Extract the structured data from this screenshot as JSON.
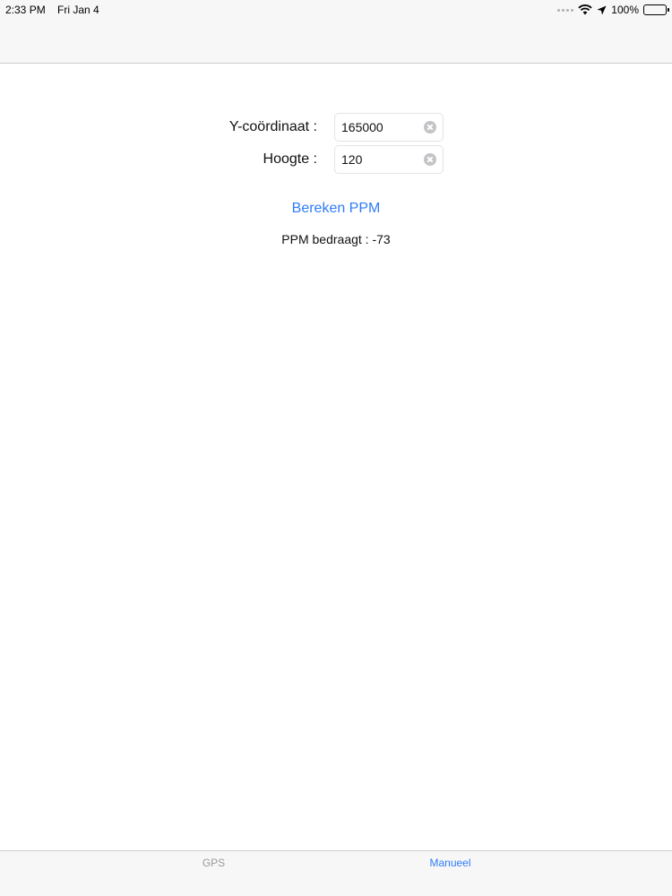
{
  "status_bar": {
    "time": "2:33 PM",
    "date": "Fri Jan 4",
    "battery_text": "100%",
    "battery_level": 1.0,
    "icons": [
      "signal-dots-icon",
      "wifi-icon",
      "location-arrow-icon",
      "battery-icon"
    ]
  },
  "form": {
    "y_coordinate": {
      "label": "Y-coördinaat :",
      "value": "165000"
    },
    "height": {
      "label": "Hoogte :",
      "value": "120"
    }
  },
  "calculate_button": {
    "label": "Bereken PPM"
  },
  "result": {
    "text": "PPM bedraagt : -73"
  },
  "tab_bar": {
    "tabs": [
      {
        "label": "GPS",
        "selected": false
      },
      {
        "label": "Manueel",
        "selected": true
      }
    ]
  },
  "colors": {
    "accent": "#2e7cf6",
    "inactive_tab": "#9a9a9a",
    "bar_background": "#f7f7f7"
  }
}
